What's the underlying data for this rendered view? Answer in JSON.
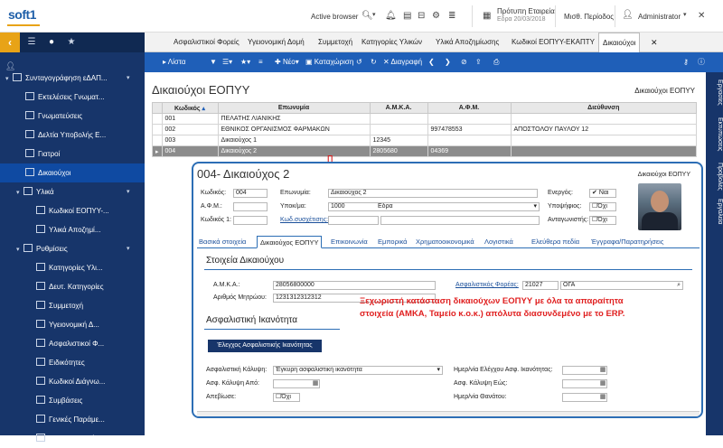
{
  "app": {
    "logo": "soft1",
    "active_browser": "Active browser",
    "company_name": "Πρότυπη Εταιρεία",
    "company_date": "Εδρα 20/03/2018",
    "period": "Μισθ. Περίοδος",
    "user": "Administrator"
  },
  "sidebar": {
    "items": [
      {
        "label": "Συνταγογράφηση εΔΑΠ..."
      },
      {
        "label": "Εκτελέσεις Γνωματ..."
      },
      {
        "label": "Γνωματεύσεις"
      },
      {
        "label": "Δελτία Υποβολής Ε..."
      },
      {
        "label": "Γιατροί"
      },
      {
        "label": "Δικαιούχοι"
      },
      {
        "label": "Υλικά"
      },
      {
        "label": "Κωδικοί ΕΟΠΥΥ-..."
      },
      {
        "label": "Υλικά Αποζημί..."
      },
      {
        "label": "Ρυθμίσεις"
      },
      {
        "label": "Κατηγορίες Υλι..."
      },
      {
        "label": "Δευτ. Κατηγορίες"
      },
      {
        "label": "Συμμετοχή"
      },
      {
        "label": "Υγειονομική Δ..."
      },
      {
        "label": "Ασφαλιστικοί Φ..."
      },
      {
        "label": "Ειδικότητες"
      },
      {
        "label": "Κωδικοί Διάγνω..."
      },
      {
        "label": "Συμβάσεις"
      },
      {
        "label": "Γενικές Παράμε..."
      },
      {
        "label": "Εισαγ. Δεδομέν..."
      }
    ]
  },
  "tabs": [
    "Ασφαλιστικοί Φορείς",
    "Υγειονομική Δομή",
    "Συμμετοχή",
    "Κατηγορίες Υλικών",
    "Υλικά Αποζημίωσης",
    "Κωδικοί ΕΟΠΥΥ-ΕΚΑΠΤΥ",
    "Δικαιούχοι"
  ],
  "toolbar": {
    "list": "Λίστα",
    "new": "Νέο",
    "save": "Καταχώριση",
    "delete": "Διαγραφή"
  },
  "right_rail": [
    "Εργασίες",
    "Εκτυπώσεις",
    "Προβολές",
    "Εργαλεία"
  ],
  "page": {
    "title": "Δικαιούχοι ΕΟΠΥΥ",
    "right_label": "Δικαιούχοι ΕΟΠΥΥ"
  },
  "grid": {
    "columns": [
      "Κωδικός",
      "Επωνυμία",
      "Α.Μ.Κ.Α.",
      "Α.Φ.Μ.",
      "Διεύθυνση"
    ],
    "rows": [
      {
        "code": "001",
        "name": "ΠΕΛΑΤΗΣ ΛΙΑΝΙΚΗΣ",
        "amka": "",
        "afm": "",
        "address": ""
      },
      {
        "code": "002",
        "name": "ΕΘΝΙΚΟΣ ΟΡΓΑΝΙΣΜΟΣ ΦΑΡΜΑΚΩΝ",
        "amka": "",
        "afm": "997478553",
        "address": "ΑΠΟΣΤΟΛΟΥ ΠΑΥΛΟΥ 12"
      },
      {
        "code": "003",
        "name": "Δικαιούχος 1",
        "amka": "12345",
        "afm": "",
        "address": ""
      },
      {
        "code": "004",
        "name": "Δικαιούχος 2",
        "amka": "2805680",
        "afm": "04369",
        "address": ""
      }
    ]
  },
  "dialog": {
    "title": "004- Δικαιούχος 2",
    "right_label": "Δικαιούχοι ΕΟΠΥΥ",
    "code_label": "Κωδικός:",
    "code_value": "004",
    "name_label": "Επωνυμία:",
    "name_value": "Δικαιούχος 2",
    "afm_label": "Α.Φ.Μ.:",
    "branch_label": "Υποκ/μα:",
    "branch_code": "1000",
    "branch_name": "Εδρα",
    "code1_label": "Κωδικός 1:",
    "related_label": "Κωδ.συσχέτισης:",
    "active_label": "Ενεργός:",
    "active_value": "Ναι",
    "candidate_label": "Υποψήφιος:",
    "candidate_value": "Όχι",
    "competitor_label": "Ανταγωνιστής:",
    "competitor_value": "Όχι",
    "tabs": [
      "Βασικά στοιχεία",
      "Δικαιούχος ΕΟΠΥΥ",
      "Επικοινωνία",
      "Εμπορικά",
      "Χρηματοοικονομικά",
      "Λογιστικά",
      "Ελεύθερα πεδία",
      "Έγγραφα/Παρατηρήσεις"
    ],
    "section1": "Στοιχεία Δικαιούχου",
    "amka_label": "Α.Μ.Κ.Α.:",
    "amka_value": "28056800000",
    "register_label": "Αριθμός Μητρώου:",
    "register_value": "1231312312312",
    "insurer_label": "Ασφαλιστικός Φορέας:",
    "insurer_code": "21027",
    "insurer_name": "ΟΓΑ",
    "section2": "Ασφαλιστική Ικανότητα",
    "check_button": "Έλεγχος Ασφαλιστικής Ικανότητας",
    "coverage_label": "Ασφαλιστική Κάλυψη:",
    "coverage_value": "Έγκυρη ασφαλιστική ικανότητα",
    "coverage_from_label": "Ασφ. Κάλυψη Από:",
    "deceased_label": "Απεβίωσε:",
    "deceased_value": "Όχι",
    "check_date_label": "Ημερ/νία Ελέγχου Ασφ. Ικανότητας:",
    "coverage_to_label": "Ασφ. Κάλυψη Εώς:",
    "death_date_label": "Ημερ/νία Θανάτου:"
  },
  "annotation": "Ξεχωριστή κατάσταση δικαιούχων ΕΟΠΥΥ με όλα τα απαραίτητα στοιχεία (ΑΜΚΑ, Ταμείο κ.ο.κ.) απόλυτα διασυνδεμένο με το ERP."
}
